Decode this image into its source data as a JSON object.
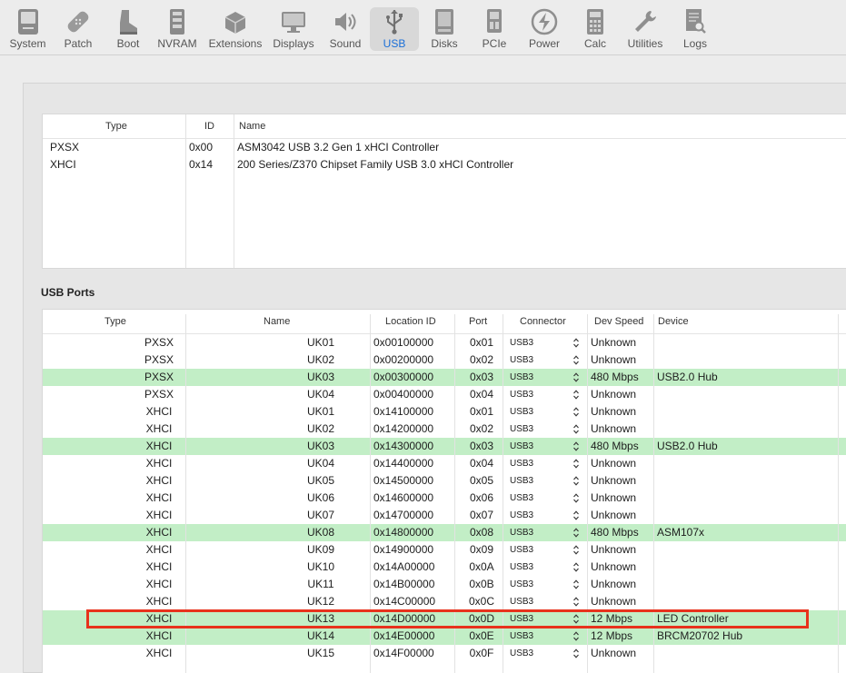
{
  "toolbar": {
    "items": [
      {
        "label": "System",
        "icon": "system-icon"
      },
      {
        "label": "Patch",
        "icon": "patch-icon"
      },
      {
        "label": "Boot",
        "icon": "boot-icon"
      },
      {
        "label": "NVRAM",
        "icon": "nvram-icon"
      },
      {
        "label": "Extensions",
        "icon": "extensions-icon"
      },
      {
        "label": "Displays",
        "icon": "displays-icon"
      },
      {
        "label": "Sound",
        "icon": "sound-icon"
      },
      {
        "label": "USB",
        "icon": "usb-icon",
        "active": true
      },
      {
        "label": "Disks",
        "icon": "disks-icon"
      },
      {
        "label": "PCIe",
        "icon": "pcie-icon"
      },
      {
        "label": "Power",
        "icon": "power-icon"
      },
      {
        "label": "Calc",
        "icon": "calc-icon"
      },
      {
        "label": "Utilities",
        "icon": "utilities-icon"
      },
      {
        "label": "Logs",
        "icon": "logs-icon"
      }
    ]
  },
  "controllers": {
    "headers": {
      "type": "Type",
      "id": "ID",
      "name": "Name"
    },
    "rows": [
      {
        "type": "PXSX",
        "id": "0x00",
        "name": "ASM3042 USB 3.2 Gen 1 xHCI Controller"
      },
      {
        "type": "XHCI",
        "id": "0x14",
        "name": "200 Series/Z370 Chipset Family USB 3.0 xHCI Controller"
      }
    ]
  },
  "usb_ports": {
    "section_label": "USB Ports",
    "headers": {
      "type": "Type",
      "name": "Name",
      "location": "Location ID",
      "port": "Port",
      "connector": "Connector",
      "speed": "Dev Speed",
      "device": "Device"
    },
    "rows": [
      {
        "type": "PXSX",
        "name": "UK01",
        "location": "0x00100000",
        "port": "0x01",
        "connector": "USB3",
        "speed": "Unknown",
        "device": "",
        "highlight": false
      },
      {
        "type": "PXSX",
        "name": "UK02",
        "location": "0x00200000",
        "port": "0x02",
        "connector": "USB3",
        "speed": "Unknown",
        "device": "",
        "highlight": false
      },
      {
        "type": "PXSX",
        "name": "UK03",
        "location": "0x00300000",
        "port": "0x03",
        "connector": "USB3",
        "speed": "480 Mbps",
        "device": "USB2.0 Hub",
        "highlight": true
      },
      {
        "type": "PXSX",
        "name": "UK04",
        "location": "0x00400000",
        "port": "0x04",
        "connector": "USB3",
        "speed": "Unknown",
        "device": "",
        "highlight": false
      },
      {
        "type": "XHCI",
        "name": "UK01",
        "location": "0x14100000",
        "port": "0x01",
        "connector": "USB3",
        "speed": "Unknown",
        "device": "",
        "highlight": false
      },
      {
        "type": "XHCI",
        "name": "UK02",
        "location": "0x14200000",
        "port": "0x02",
        "connector": "USB3",
        "speed": "Unknown",
        "device": "",
        "highlight": false
      },
      {
        "type": "XHCI",
        "name": "UK03",
        "location": "0x14300000",
        "port": "0x03",
        "connector": "USB3",
        "speed": "480 Mbps",
        "device": "USB2.0 Hub",
        "highlight": true
      },
      {
        "type": "XHCI",
        "name": "UK04",
        "location": "0x14400000",
        "port": "0x04",
        "connector": "USB3",
        "speed": "Unknown",
        "device": "",
        "highlight": false
      },
      {
        "type": "XHCI",
        "name": "UK05",
        "location": "0x14500000",
        "port": "0x05",
        "connector": "USB3",
        "speed": "Unknown",
        "device": "",
        "highlight": false
      },
      {
        "type": "XHCI",
        "name": "UK06",
        "location": "0x14600000",
        "port": "0x06",
        "connector": "USB3",
        "speed": "Unknown",
        "device": "",
        "highlight": false
      },
      {
        "type": "XHCI",
        "name": "UK07",
        "location": "0x14700000",
        "port": "0x07",
        "connector": "USB3",
        "speed": "Unknown",
        "device": "",
        "highlight": false
      },
      {
        "type": "XHCI",
        "name": "UK08",
        "location": "0x14800000",
        "port": "0x08",
        "connector": "USB3",
        "speed": "480 Mbps",
        "device": "ASM107x",
        "highlight": true
      },
      {
        "type": "XHCI",
        "name": "UK09",
        "location": "0x14900000",
        "port": "0x09",
        "connector": "USB3",
        "speed": "Unknown",
        "device": "",
        "highlight": false
      },
      {
        "type": "XHCI",
        "name": "UK10",
        "location": "0x14A00000",
        "port": "0x0A",
        "connector": "USB3",
        "speed": "Unknown",
        "device": "",
        "highlight": false
      },
      {
        "type": "XHCI",
        "name": "UK11",
        "location": "0x14B00000",
        "port": "0x0B",
        "connector": "USB3",
        "speed": "Unknown",
        "device": "",
        "highlight": false
      },
      {
        "type": "XHCI",
        "name": "UK12",
        "location": "0x14C00000",
        "port": "0x0C",
        "connector": "USB3",
        "speed": "Unknown",
        "device": "",
        "highlight": false
      },
      {
        "type": "XHCI",
        "name": "UK13",
        "location": "0x14D00000",
        "port": "0x0D",
        "connector": "USB3",
        "speed": "12 Mbps",
        "device": "LED Controller",
        "highlight": true
      },
      {
        "type": "XHCI",
        "name": "UK14",
        "location": "0x14E00000",
        "port": "0x0E",
        "connector": "USB3",
        "speed": "12 Mbps",
        "device": "BRCM20702 Hub",
        "highlight": true
      },
      {
        "type": "XHCI",
        "name": "UK15",
        "location": "0x14F00000",
        "port": "0x0F",
        "connector": "USB3",
        "speed": "Unknown",
        "device": "",
        "highlight": false
      }
    ]
  },
  "colors": {
    "highlight_row": "#c2eec6",
    "annotation_box": "#e8321c",
    "active_tab": "#1a6fd8"
  }
}
